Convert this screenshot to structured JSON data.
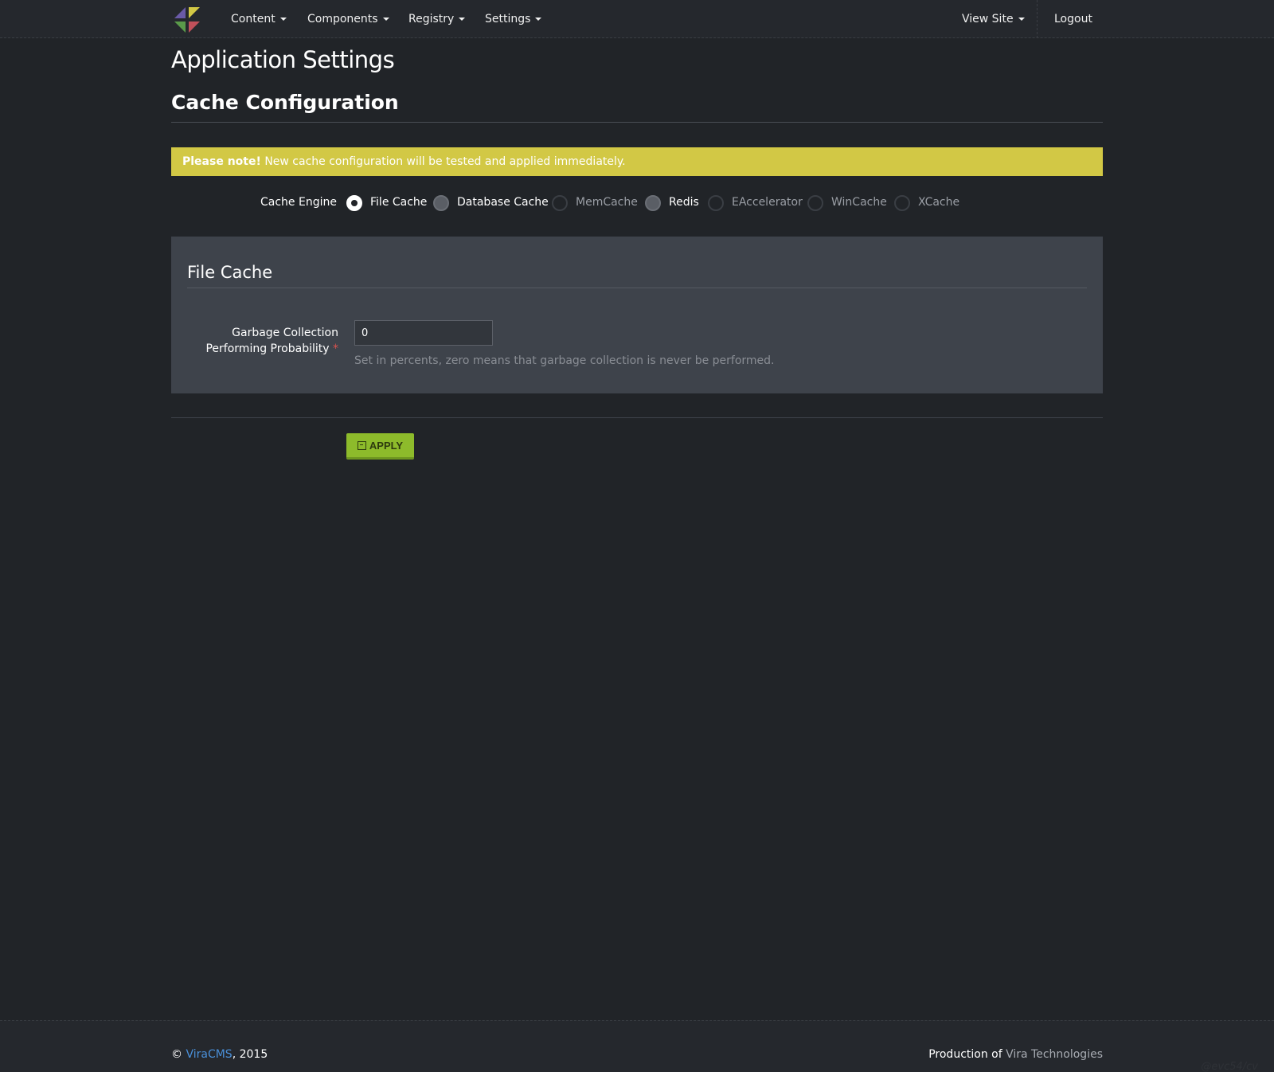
{
  "nav": {
    "items": [
      {
        "label": "Content"
      },
      {
        "label": "Components"
      },
      {
        "label": "Registry"
      },
      {
        "label": "Settings"
      }
    ],
    "view_site": "View Site",
    "logout": "Logout"
  },
  "page": {
    "title": "Application Settings",
    "section_title": "Cache Configuration"
  },
  "alert": {
    "strong": "Please note!",
    "text": " New cache configuration will be tested and applied immediately."
  },
  "cache_engine": {
    "label": "Cache Engine",
    "selected": "File Cache",
    "options": [
      {
        "label": "File Cache",
        "state": "checked"
      },
      {
        "label": "Database Cache",
        "state": "enabled"
      },
      {
        "label": "MemCache",
        "state": "disabled"
      },
      {
        "label": "Redis",
        "state": "enabled"
      },
      {
        "label": "EAccelerator",
        "state": "disabled"
      },
      {
        "label": "WinCache",
        "state": "disabled"
      },
      {
        "label": "XCache",
        "state": "disabled"
      }
    ]
  },
  "panel": {
    "title": "File Cache",
    "field_label_line1": "Garbage Collection",
    "field_label_line2": "Performing Probability",
    "required_mark": "*",
    "field_value": "0",
    "help": "Set in percents, zero means that garbage collection is never be performed."
  },
  "actions": {
    "apply_label": "APPLY"
  },
  "footer": {
    "copyright_symbol": "©",
    "brand_link": "ViraCMS",
    "year": ", 2015",
    "production_of": "Production of ",
    "company_link": "Vira Technologies",
    "watermark": "@evc54/cv"
  },
  "colors": {
    "background": "#212428",
    "alert": "#d2c845",
    "apply": "#8dbb2b",
    "link": "#4a90d9"
  }
}
